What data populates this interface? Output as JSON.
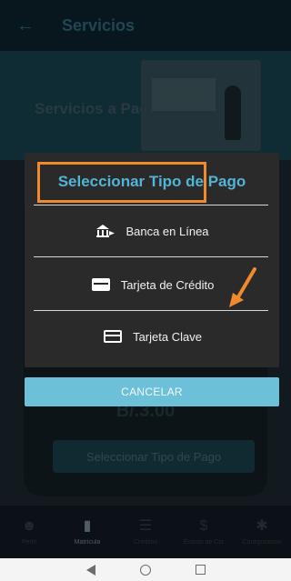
{
  "appbar": {
    "back_icon": "arrow-left-icon",
    "title": "Servicios"
  },
  "banner": {
    "title": "Servicios a Pagar"
  },
  "background": {
    "amount": "B/.3.00",
    "select_button": "Seleccionar Tipo de Pago"
  },
  "bottom_nav": {
    "items": [
      {
        "label": "Perfil",
        "icon": "people-icon"
      },
      {
        "label": "Matrícula",
        "icon": "document-icon"
      },
      {
        "label": "Créditos",
        "icon": "list-icon"
      },
      {
        "label": "Estado de Cta",
        "icon": "dollar-icon"
      },
      {
        "label": "Configuración",
        "icon": "gear-icon"
      }
    ],
    "active_index": 1
  },
  "dialog": {
    "title": "Seleccionar Tipo de Pago",
    "options": [
      {
        "label": "Banca en Línea",
        "icon": "bank-icon"
      },
      {
        "label": "Tarjeta de Crédito",
        "icon": "credit-card-icon"
      },
      {
        "label": "Tarjeta Clave",
        "icon": "credit-card-outline-icon"
      }
    ],
    "cancel_label": "CANCELAR"
  },
  "annotation": {
    "highlight_color": "#f08a2c",
    "highlighted_option": "Tarjeta Clave"
  }
}
